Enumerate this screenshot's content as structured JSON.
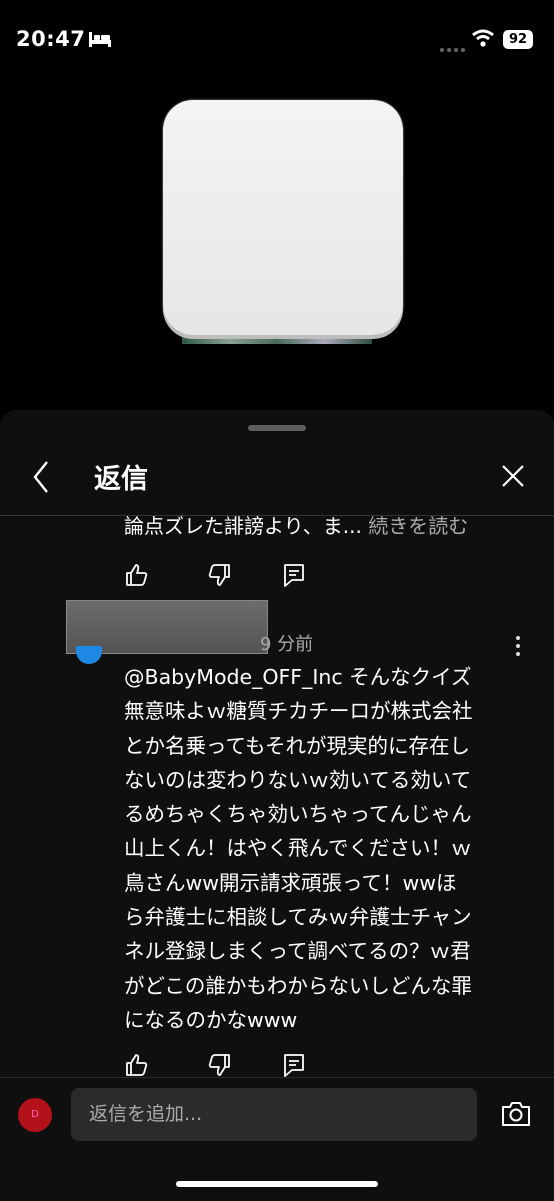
{
  "status_bar": {
    "time": "20:47",
    "battery": "92",
    "icons": [
      "bed-icon",
      "signal-dots-icon",
      "wifi-icon",
      "battery-icon"
    ]
  },
  "sheet": {
    "title": "返信",
    "back_icon": "chevron-left-icon",
    "close_icon": "close-icon"
  },
  "previous_comment": {
    "snippet": "論点ズレた誹謗より、ま... ",
    "read_more": "続きを読む",
    "actions": [
      "like-icon",
      "dislike-icon",
      "reply-icon"
    ]
  },
  "reply_comment": {
    "time_ago": "9 分前",
    "text": "@BabyMode_OFF_Inc そんなクイズ\n無意味よｗ糖質チカチーロが株式会社\nとか名乗ってもそれが現実的に存在し\nないのは変わりないｗ効いてる効いて\nるめちゃくちゃ効いちゃってんじゃん\n山上くん！はやく飛んでください！ｗ\n鳥さんww開示請求頑張って！wwほ\nら弁護士に相談してみｗ弁護士チャン\nネル登録しまくって調べてるの？ｗ君\nがどこの誰かもわからないしどんな罪\nになるのかなwww",
    "actions": [
      "like-icon",
      "dislike-icon",
      "reply-icon"
    ]
  },
  "bottom_bar": {
    "avatar_initial": "D",
    "input_placeholder": "返信を追加...",
    "camera_icon": "camera-icon"
  }
}
